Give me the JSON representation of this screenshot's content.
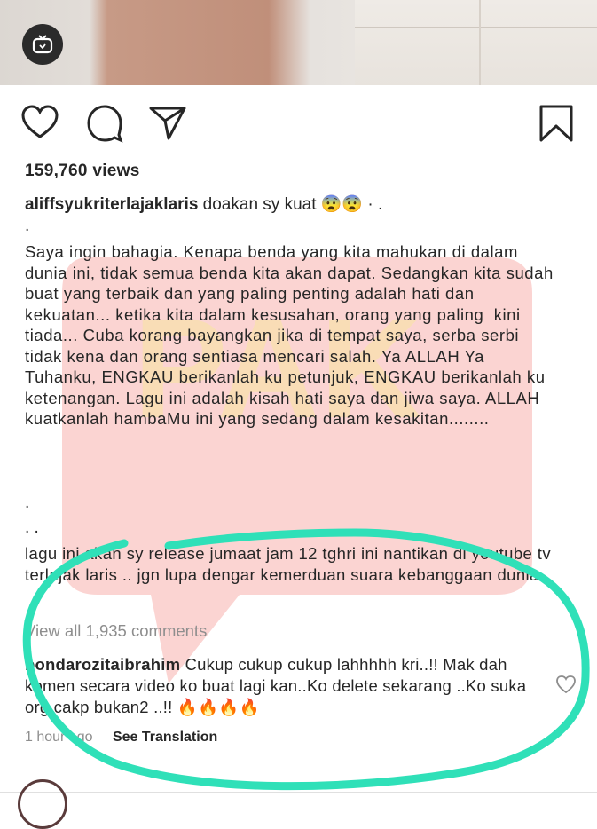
{
  "post": {
    "views": "159,760 views",
    "username": "aliffsyukriterlajaklaris",
    "caption_first": "doakan sy kuat",
    "caption_first_tail": "· .",
    "paragraph": "Saya ingin bahagia. Kenapa benda yang kita mahukan di dalam dunia ini, tidak semua benda kita akan dapat. Sedangkan kita sudah buat yang terbaik dan yang paling penting adalah hati dan kekuatan... ketika kita dalam kesusahan, orang yang paling  kini tiada... Cuba korang bayangkan jika di tempat saya, serba serbi tidak kena dan orang sentiasa mencari salah. Ya ALLAH Ya Tuhanku, ENGKAU berikanlah ku petunjuk, ENGKAU berikanlah ku ketenangan. Lagu ini adalah kisah hati saya dan jiwa saya. ALLAH kuatkanlah hambaMu ini yang sedang dalam kesakitan........",
    "dot_a": ".",
    "dot_b": ".",
    "dot_c": ". .",
    "song_line": "lagu ini akan sy release jumaat jam 12 tghri ini nantikan di youtube tv terlajak laris .. jgn lupa dengar kemerduan suara kebanggaan dunia",
    "view_all": "View all 1,935 comments"
  },
  "comment": {
    "username": "bondarozitaibrahim",
    "text": "Cukup cukup cukup lahhhhh kri..!! Mak dah komen secara video ko buat lagi kan..Ko delete sekarang ..Ko suka org cakp bukan2 ..!! 🔥🔥🔥🔥",
    "time": "1 hour ago",
    "translate": "See Translation"
  },
  "icons": {
    "like": "heart-icon",
    "comment": "comment-icon",
    "share": "send-icon",
    "save": "bookmark-icon",
    "tv": "igtv-icon",
    "comment_like": "heart-icon"
  },
  "colors": {
    "annotation": "#2fe0b8",
    "watermark": "#f7b1ad",
    "muted": "#8e8e8e"
  }
}
